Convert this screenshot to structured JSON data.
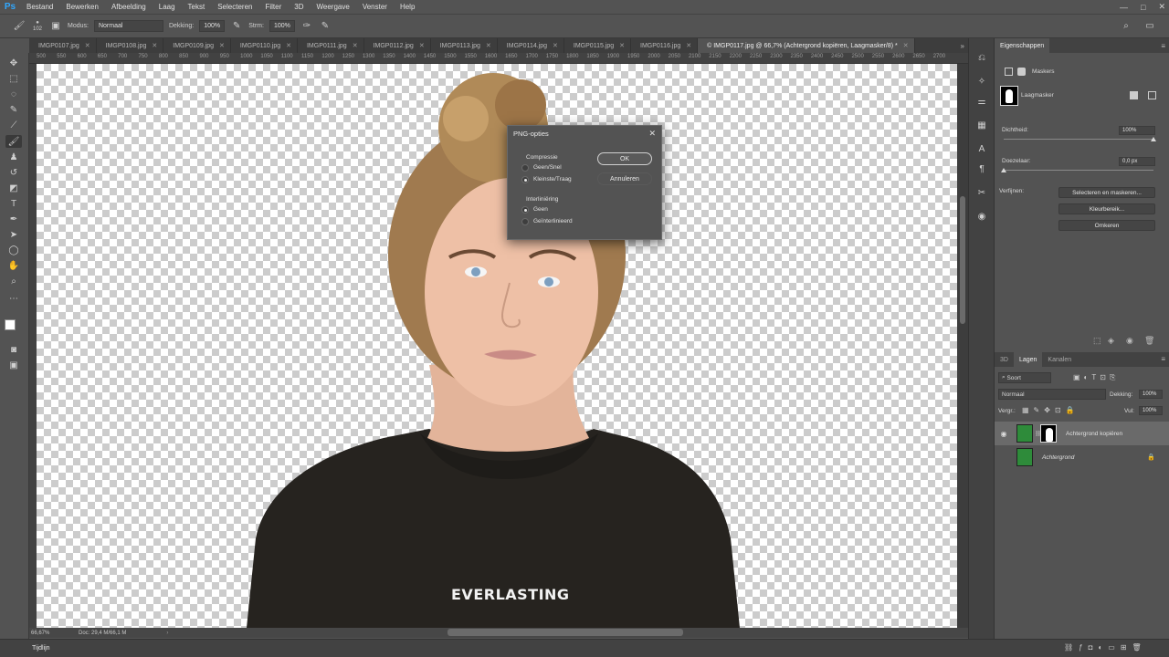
{
  "app": {
    "logo": "Ps"
  },
  "menu": [
    "Bestand",
    "Bewerken",
    "Afbeelding",
    "Laag",
    "Tekst",
    "Selecteren",
    "Filter",
    "3D",
    "Weergave",
    "Venster",
    "Help"
  ],
  "window_controls": {
    "minimize": "—",
    "maximize": "□",
    "close": "✕"
  },
  "options_bar": {
    "brush_size": "102",
    "mode_label": "Modus:",
    "mode_value": "Normaal",
    "opacity_label": "Dekking:",
    "opacity_value": "100%",
    "flow_label": "Strm:",
    "flow_value": "100%"
  },
  "tabs": [
    {
      "label": "IMGP0107.jpg"
    },
    {
      "label": "IMGP0108.jpg"
    },
    {
      "label": "IMGP0109.jpg"
    },
    {
      "label": "IMGP0110.jpg"
    },
    {
      "label": "IMGP0111.jpg"
    },
    {
      "label": "IMGP0112.jpg"
    },
    {
      "label": "IMGP0113.jpg"
    },
    {
      "label": "IMGP0114.jpg"
    },
    {
      "label": "IMGP0115.jpg"
    },
    {
      "label": "IMGP0116.jpg"
    },
    {
      "label": "© IMGP0117.jpg @ 66,7% (Achtergrond kopiëren, Laagmasker/8) *"
    }
  ],
  "ruler_numbers": [
    "500",
    "550",
    "600",
    "650",
    "700",
    "750",
    "800",
    "850",
    "900",
    "950",
    "1000",
    "1050",
    "1100",
    "1150",
    "1200",
    "1250",
    "1300",
    "1350",
    "1400",
    "1450",
    "1500",
    "1550",
    "1600",
    "1650",
    "1700",
    "1750",
    "1800",
    "1850",
    "1900",
    "1950",
    "2000",
    "2050",
    "2100",
    "2150",
    "2200",
    "2250",
    "2300",
    "2350",
    "2400",
    "2450",
    "2500",
    "2550",
    "2600",
    "2650",
    "2700"
  ],
  "canvas": {
    "shirt_text": "EVERLASTING"
  },
  "status": {
    "zoom": "66,67%",
    "doc": "Doc: 29,4 M/66,1 M"
  },
  "timeline_label": "Tijdlijn",
  "properties": {
    "header": "Eigenschappen",
    "masks_title": "Maskers",
    "layer_mask_label": "Laagmasker",
    "density_label": "Dichtheid:",
    "density_value": "100%",
    "density_level": 1.0,
    "feather_label": "Doezelaar:",
    "feather_value": "0,0 px",
    "feather_level": 0.0,
    "refine_label": "Verfijnen:",
    "buttons": [
      "Selecteren en maskeren...",
      "Kleurbereik...",
      "Omkeren"
    ]
  },
  "layers_panel": {
    "tabs": [
      "3D",
      "Lagen",
      "Kanalen"
    ],
    "kind_filter": "Soort",
    "blend_mode": "Normaal",
    "opacity_label": "Dekking:",
    "opacity_value": "100%",
    "lock_label": "Vergr.:",
    "fill_label": "Vul:",
    "fill_value": "100%",
    "layers": [
      {
        "name": "Achtergrond kopiëren"
      },
      {
        "name": "Achtergrond"
      }
    ]
  },
  "dialog": {
    "title": "PNG-opties",
    "compression_label": "Compressie",
    "compression_options": [
      {
        "label": "Geen/Snel",
        "selected": false
      },
      {
        "label": "Kleinste/Traag",
        "selected": true
      }
    ],
    "interlace_label": "Interliniëring",
    "interlace_options": [
      {
        "label": "Geen",
        "selected": true
      },
      {
        "label": "Geïnterlinieerd",
        "selected": false
      }
    ],
    "ok_label": "OK",
    "cancel_label": "Annuleren"
  }
}
